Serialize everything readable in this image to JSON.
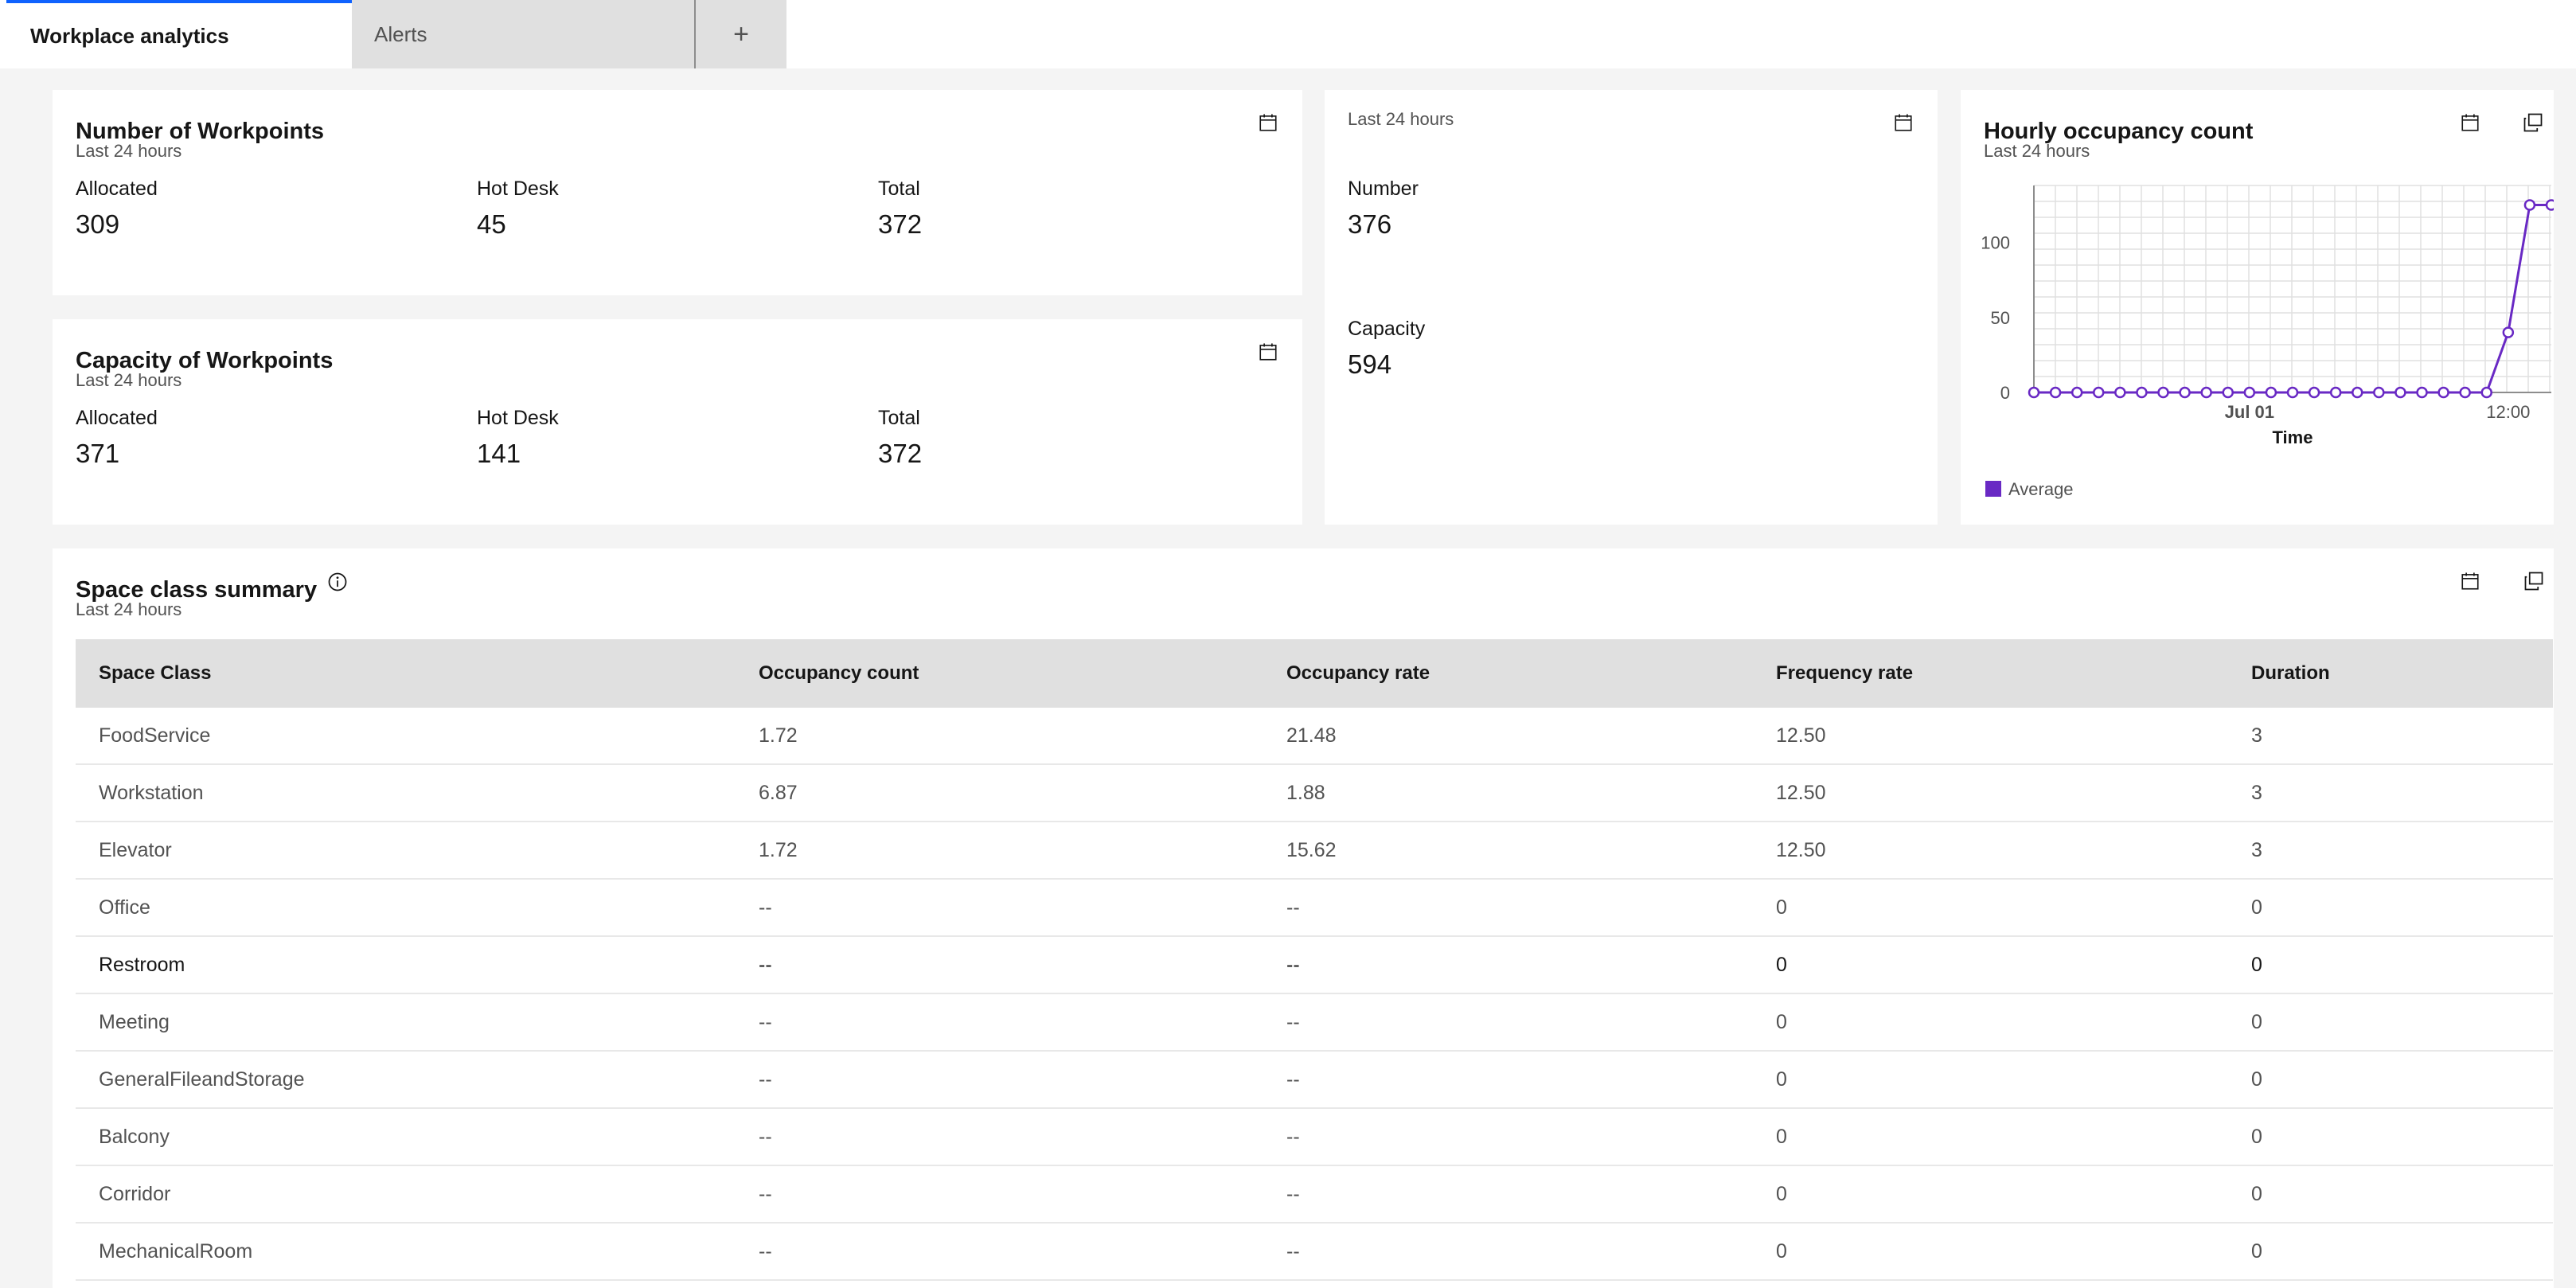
{
  "tabs": [
    {
      "label": "Workplace analytics"
    },
    {
      "label": "Alerts"
    },
    {
      "label": "+"
    }
  ],
  "workpoints": {
    "title": "Number of Workpoints",
    "subtitle": "Last 24 hours",
    "metrics": [
      {
        "label": "Allocated",
        "value": "309"
      },
      {
        "label": "Hot Desk",
        "value": "45"
      },
      {
        "label": "Total",
        "value": "372"
      }
    ]
  },
  "capacity": {
    "title": "Capacity of Workpoints",
    "subtitle": "Last 24 hours",
    "metrics": [
      {
        "label": "Allocated",
        "value": "371"
      },
      {
        "label": "Hot Desk",
        "value": "141"
      },
      {
        "label": "Total",
        "value": "372"
      }
    ]
  },
  "summary_tile": {
    "subtitle": "Last 24 hours",
    "number_label": "Number",
    "number_value": "376",
    "capacity_label": "Capacity",
    "capacity_value": "594"
  },
  "hourly": {
    "title": "Hourly occupancy count",
    "subtitle": "Last 24 hours"
  },
  "chart_data": {
    "type": "line",
    "xlabel": "Time",
    "ylabel": "",
    "x_tick_labels": [
      "Jul 01",
      "12:00"
    ],
    "y_tick_labels": [
      "0",
      "50",
      "100"
    ],
    "ylim": [
      0,
      138
    ],
    "grid": true,
    "legend": "bottom-left",
    "series": [
      {
        "name": "Average",
        "color": "#6929c4",
        "values": [
          0,
          0,
          0,
          0,
          0,
          0,
          0,
          0,
          0,
          0,
          0,
          0,
          0,
          0,
          0,
          0,
          0,
          0,
          0,
          0,
          0,
          0,
          40,
          125,
          125
        ]
      }
    ]
  },
  "space_class": {
    "title": "Space class summary",
    "subtitle": "Last 24 hours",
    "columns": [
      "Space Class",
      "Occupancy count",
      "Occupancy rate",
      "Frequency rate",
      "Duration"
    ],
    "rows": [
      [
        "FoodService",
        "1.72",
        "21.48",
        "12.50",
        "3"
      ],
      [
        "Workstation",
        "6.87",
        "1.88",
        "12.50",
        "3"
      ],
      [
        "Elevator",
        "1.72",
        "15.62",
        "12.50",
        "3"
      ],
      [
        "Office",
        "--",
        "--",
        "0",
        "0"
      ],
      [
        "Restroom",
        "--",
        "--",
        "0",
        "0"
      ],
      [
        "Meeting",
        "--",
        "--",
        "0",
        "0"
      ],
      [
        "GeneralFileandStorage",
        "--",
        "--",
        "0",
        "0"
      ],
      [
        "Balcony",
        "--",
        "--",
        "0",
        "0"
      ],
      [
        "Corridor",
        "--",
        "--",
        "0",
        "0"
      ],
      [
        "MechanicalRoom",
        "--",
        "--",
        "0",
        "0"
      ]
    ]
  },
  "colors": {
    "accent": "#0f62fe",
    "series": "#6929c4"
  }
}
